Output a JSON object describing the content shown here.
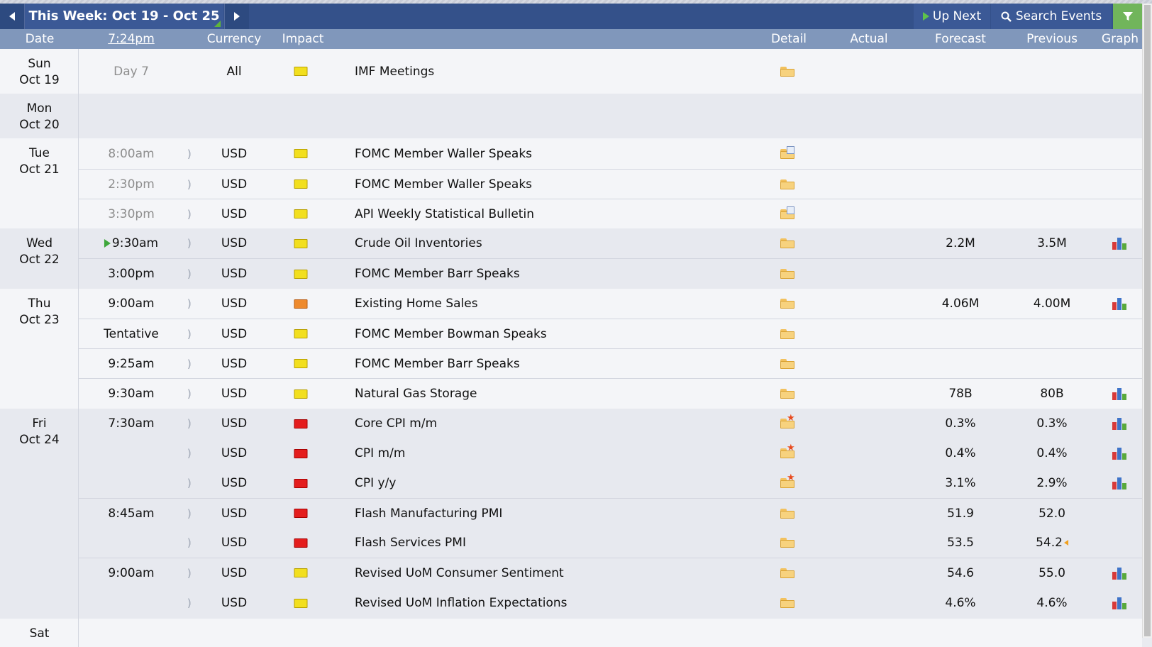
{
  "toolbar": {
    "week_title": "This Week: Oct 19 - Oct 25",
    "up_next": "Up Next",
    "search_events": "Search Events"
  },
  "header": {
    "date": "Date",
    "time": "7:24pm",
    "currency": "Currency",
    "impact": "Impact",
    "detail": "Detail",
    "actual": "Actual",
    "forecast": "Forecast",
    "previous": "Previous",
    "graph": "Graph"
  },
  "colors": {
    "toolbar": "#34518a",
    "header": "#8097bb",
    "filter": "#71b55b",
    "high_impact": "#e41d1d",
    "medium_impact": "#ee8a2d",
    "low_impact": "#f2df1e"
  },
  "days": [
    {
      "dow": "Sun",
      "date": "Oct 19"
    },
    {
      "dow": "Mon",
      "date": "Oct 20"
    },
    {
      "dow": "Tue",
      "date": "Oct 21"
    },
    {
      "dow": "Wed",
      "date": "Oct 22"
    },
    {
      "dow": "Thu",
      "date": "Oct 23"
    },
    {
      "dow": "Fri",
      "date": "Oct 24"
    },
    {
      "dow": "Sat",
      "date": ""
    }
  ],
  "events": [
    {
      "time": "Day 7",
      "currency": "All",
      "impact": "low",
      "event": "IMF Meetings",
      "detail": "folder",
      "forecast": "",
      "previous": "",
      "graph": false
    },
    {
      "time": "8:00am",
      "currency": "USD",
      "impact": "low",
      "event": "FOMC Member Waller Speaks",
      "detail": "folder-doc",
      "forecast": "",
      "previous": "",
      "graph": false
    },
    {
      "time": "2:30pm",
      "currency": "USD",
      "impact": "low",
      "event": "FOMC Member Waller Speaks",
      "detail": "folder",
      "forecast": "",
      "previous": "",
      "graph": false
    },
    {
      "time": "3:30pm",
      "currency": "USD",
      "impact": "low",
      "event": "API Weekly Statistical Bulletin",
      "detail": "folder-doc",
      "forecast": "",
      "previous": "",
      "graph": false
    },
    {
      "time": "9:30am",
      "currency": "USD",
      "impact": "low",
      "event": "Crude Oil Inventories",
      "detail": "folder",
      "forecast": "2.2M",
      "previous": "3.5M",
      "graph": true
    },
    {
      "time": "3:00pm",
      "currency": "USD",
      "impact": "low",
      "event": "FOMC Member Barr Speaks",
      "detail": "folder",
      "forecast": "",
      "previous": "",
      "graph": false
    },
    {
      "time": "9:00am",
      "currency": "USD",
      "impact": "medium",
      "event": "Existing Home Sales",
      "detail": "folder",
      "forecast": "4.06M",
      "previous": "4.00M",
      "graph": true
    },
    {
      "time": "Tentative",
      "currency": "USD",
      "impact": "low",
      "event": "FOMC Member Bowman Speaks",
      "detail": "folder",
      "forecast": "",
      "previous": "",
      "graph": false
    },
    {
      "time": "9:25am",
      "currency": "USD",
      "impact": "low",
      "event": "FOMC Member Barr Speaks",
      "detail": "folder",
      "forecast": "",
      "previous": "",
      "graph": false
    },
    {
      "time": "9:30am",
      "currency": "USD",
      "impact": "low",
      "event": "Natural Gas Storage",
      "detail": "folder",
      "forecast": "78B",
      "previous": "80B",
      "graph": true
    },
    {
      "time": "7:30am",
      "currency": "USD",
      "impact": "high",
      "event": "Core CPI m/m",
      "detail": "folder-star",
      "forecast": "0.3%",
      "previous": "0.3%",
      "graph": true
    },
    {
      "time": "",
      "currency": "USD",
      "impact": "high",
      "event": "CPI m/m",
      "detail": "folder-star",
      "forecast": "0.4%",
      "previous": "0.4%",
      "graph": true
    },
    {
      "time": "",
      "currency": "USD",
      "impact": "high",
      "event": "CPI y/y",
      "detail": "folder-star",
      "forecast": "3.1%",
      "previous": "2.9%",
      "graph": true
    },
    {
      "time": "8:45am",
      "currency": "USD",
      "impact": "high",
      "event": "Flash Manufacturing PMI",
      "detail": "folder",
      "forecast": "51.9",
      "previous": "52.0",
      "graph": false
    },
    {
      "time": "",
      "currency": "USD",
      "impact": "high",
      "event": "Flash Services PMI",
      "detail": "folder",
      "forecast": "53.5",
      "previous": "54.2",
      "graph": false
    },
    {
      "time": "9:00am",
      "currency": "USD",
      "impact": "low",
      "event": "Revised UoM Consumer Sentiment",
      "detail": "folder",
      "forecast": "54.6",
      "previous": "55.0",
      "graph": true
    },
    {
      "time": "",
      "currency": "USD",
      "impact": "low",
      "event": "Revised UoM Inflation Expectations",
      "detail": "folder",
      "forecast": "4.6%",
      "previous": "4.6%",
      "graph": true
    }
  ]
}
